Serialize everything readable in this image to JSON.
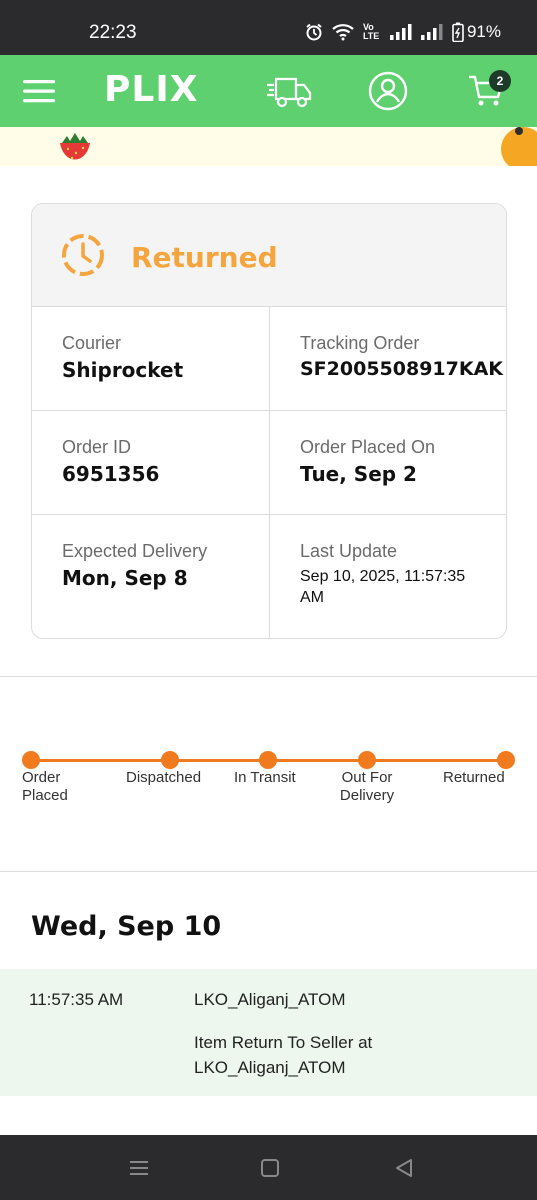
{
  "status_bar": {
    "time": "22:23",
    "network_label": "Vo LTE",
    "battery": "91%"
  },
  "header": {
    "logo": "PLIX",
    "cart_count": "2"
  },
  "order": {
    "status": "Returned",
    "fields": [
      {
        "label": "Courier",
        "value": "Shiprocket"
      },
      {
        "label": "Tracking Order",
        "value": "SF2005508917KAK"
      },
      {
        "label": "Order ID",
        "value": "6951356"
      },
      {
        "label": "Order Placed On",
        "value": "Tue, Sep 2"
      },
      {
        "label": "Expected Delivery",
        "value": "Mon, Sep 8"
      },
      {
        "label": "Last Update",
        "value": "Sep 10, 2025, 11:57:35 AM"
      }
    ]
  },
  "tracker": {
    "steps": [
      "Order\nPlaced",
      "Dispatched",
      "In Transit",
      "Out For\nDelivery",
      "Returned"
    ],
    "completed_steps": 5,
    "accent_color": "#f07b1f"
  },
  "history": {
    "date": "Wed, Sep 10",
    "entries": [
      {
        "time": "11:57:35 AM",
        "location": "LKO_Aliganj_ATOM",
        "description": "Item Return To Seller at LKO_Aliganj_ATOM"
      }
    ]
  },
  "colors": {
    "brand": "#5fd070",
    "status": "#f4a53d"
  }
}
